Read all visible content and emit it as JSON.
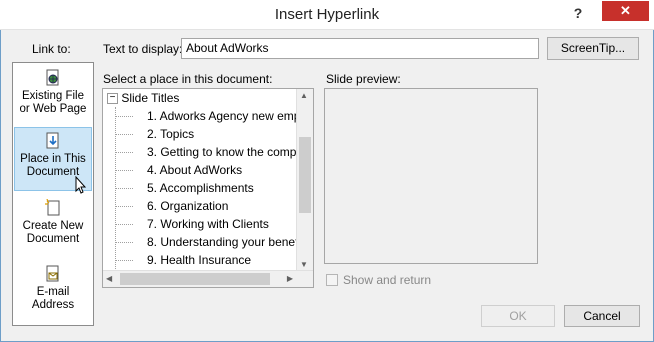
{
  "window": {
    "title": "Insert Hyperlink",
    "help_label": "?",
    "close_label": "✕"
  },
  "link_to": {
    "label": "Link to:",
    "items": [
      {
        "label_line1": "Existing File",
        "label_line2": "or Web Page",
        "icon": "globe-file-icon",
        "selected": false
      },
      {
        "label_line1": "Place in This",
        "label_line2": "Document",
        "icon": "document-place-icon",
        "selected": true
      },
      {
        "label_line1": "Create New",
        "label_line2": "Document",
        "icon": "new-document-icon",
        "selected": false
      },
      {
        "label_line1": "E-mail",
        "label_line2": "Address",
        "icon": "email-icon",
        "selected": false
      }
    ]
  },
  "text_to_display": {
    "label": "Text to display:",
    "value": "About AdWorks"
  },
  "screentip_button": "ScreenTip...",
  "place_section": {
    "label": "Select a place in this document:",
    "root": "Slide Titles",
    "slides": [
      "1. Adworks Agency  new emp",
      "2. Topics",
      "3. Getting to know the comp",
      "4. About AdWorks",
      "5. Accomplishments",
      "6. Organization",
      "7. Working with Clients",
      "8. Understanding your benef",
      "9. Health Insurance"
    ]
  },
  "preview": {
    "label": "Slide preview:",
    "show_and_return": "Show and return"
  },
  "buttons": {
    "ok": "OK",
    "cancel": "Cancel"
  }
}
